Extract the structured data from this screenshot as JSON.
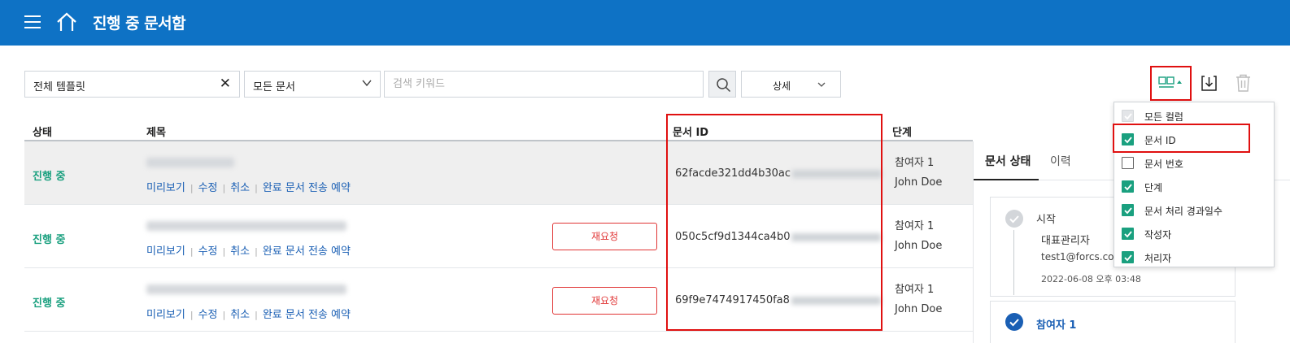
{
  "header": {
    "title": "진행 중 문서함"
  },
  "filters": {
    "template_value": "전체 템플릿",
    "doc_type_value": "모든 문서",
    "keyword_placeholder": "검색 키워드",
    "detail_label": "상세"
  },
  "columns": {
    "status": "상태",
    "title": "제목",
    "doc_id": "문서 ID",
    "stage": "단계"
  },
  "row_actions": {
    "preview": "미리보기",
    "edit": "수정",
    "cancel": "취소",
    "schedule": "완료 문서 전송 예약",
    "rerequest": "재요청"
  },
  "rows": [
    {
      "status": "진행 중",
      "doc_id": "62facde321dd4b30ac",
      "stage_role": "참여자 1",
      "stage_user": "John Doe"
    },
    {
      "status": "진행 중",
      "doc_id": "050c5cf9d1344ca4b0",
      "stage_role": "참여자 1",
      "stage_user": "John Doe"
    },
    {
      "status": "진행 중",
      "doc_id": "69f9e7474917450fa8",
      "stage_role": "참여자 1",
      "stage_user": "John Doe"
    }
  ],
  "side_panel": {
    "tab_status": "문서 상태",
    "tab_history": "이력",
    "step1": {
      "label": "시작",
      "user": "대표관리자",
      "email": "test1@forcs.com",
      "time": "2022-06-08 오후 03:48"
    },
    "step2": {
      "label": "참여자 1"
    }
  },
  "column_menu": {
    "items": [
      {
        "label": "모든 컬럼",
        "state": "disabled"
      },
      {
        "label": "문서 ID",
        "state": "checked"
      },
      {
        "label": "문서 번호",
        "state": "unchecked"
      },
      {
        "label": "단계",
        "state": "checked"
      },
      {
        "label": "문서 처리 경과일수",
        "state": "checked"
      },
      {
        "label": "작성자",
        "state": "checked"
      },
      {
        "label": "처리자",
        "state": "checked"
      }
    ]
  },
  "colors": {
    "header_bg": "#0e72c5",
    "status_green": "#1aa07f",
    "link_blue": "#1a5fb4",
    "highlight_red": "#e01010"
  }
}
